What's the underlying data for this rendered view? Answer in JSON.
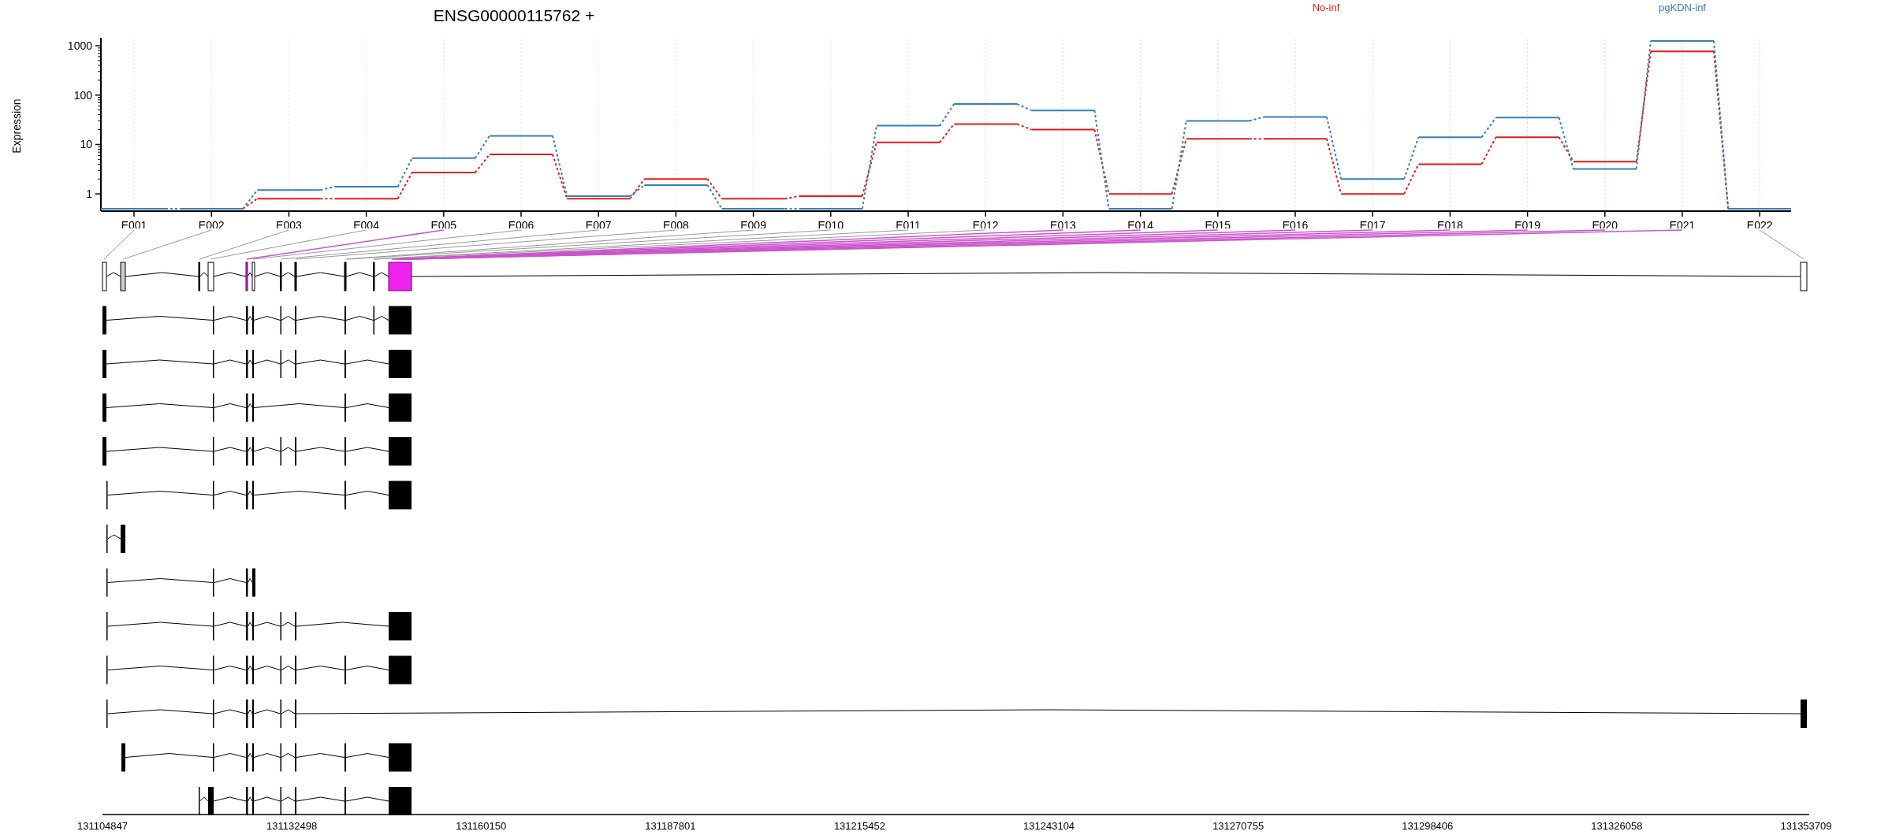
{
  "plot": {
    "title": "ENSG00000115762 +",
    "ylabel": "Expression",
    "legend": [
      {
        "name": "No-inf",
        "color": "#e41a1c"
      },
      {
        "name": "pgKDN-inf",
        "color": "#377eb8"
      }
    ],
    "y_axis_labels": [
      "1000",
      "100",
      "10",
      "1"
    ],
    "exon_labels": [
      "E001",
      "E002",
      "E003",
      "E004",
      "E005",
      "E006",
      "E007",
      "E008",
      "E009",
      "E010",
      "E011",
      "E012",
      "E013",
      "E014",
      "E015",
      "E016",
      "E017",
      "E018",
      "E019",
      "E020",
      "E021",
      "E022"
    ]
  },
  "genomic_axis": {
    "ticks": [
      "131104847",
      "131132498",
      "131160150",
      "131187801",
      "131215452",
      "131243104",
      "131270755",
      "131298406",
      "131326058",
      "131353709"
    ]
  }
}
